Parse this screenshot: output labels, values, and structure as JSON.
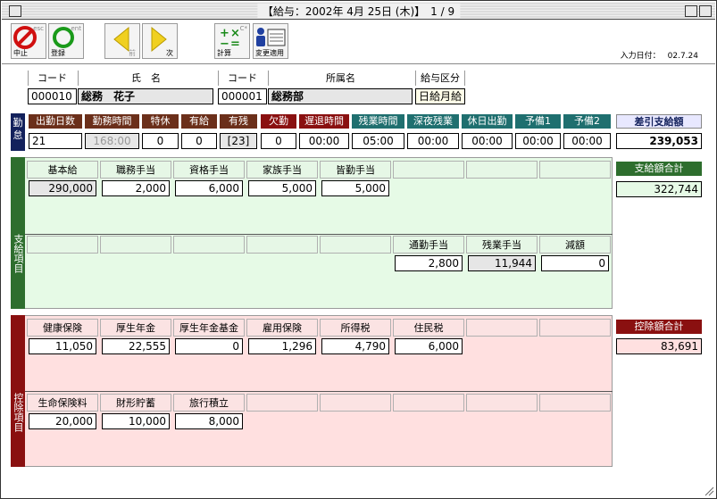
{
  "window": {
    "title": "【給与：2002年 4月 25日 (木)】　1 / 9"
  },
  "toolbar": {
    "stop_label": "中止",
    "stop_hint": "esc",
    "register_label": "登録",
    "register_hint": "ent",
    "prev_label": "前",
    "next_label": "次",
    "calc_label": "計算",
    "calc_hint": "C*",
    "apply_label": "変更適用",
    "input_date_label": "入力日付：",
    "input_date_value": "02.7.24"
  },
  "employee": {
    "code_header": "コード",
    "name_header": "氏　名",
    "dept_code_header": "コード",
    "dept_name_header": "所属名",
    "pay_type_header": "給与区分",
    "code": "000010",
    "name": "総務　花子",
    "dept_code": "000001",
    "dept_name": "総務部",
    "pay_type": "日給月給"
  },
  "attendance": {
    "side_label": "勤怠",
    "labels": [
      "出勤日数",
      "勤務時間",
      "特休",
      "有給",
      "有残",
      "欠勤",
      "遅退時間",
      "残業時間",
      "深夜残業",
      "休日出勤",
      "予備1",
      "予備2"
    ],
    "values": [
      "21",
      "168:00",
      "0",
      "0",
      "[23]",
      "0",
      "00:00",
      "05:00",
      "00:00",
      "00:00",
      "00:00",
      "00:00"
    ],
    "net_label": "差引支給額",
    "net_value": "239,053"
  },
  "payments": {
    "side_label": "支給項目",
    "row1_labels": [
      "基本給",
      "職務手当",
      "資格手当",
      "家族手当",
      "皆勤手当",
      "",
      "",
      ""
    ],
    "row1_values": [
      "290,000",
      "2,000",
      "6,000",
      "5,000",
      "5,000"
    ],
    "row2_labels": [
      "",
      "",
      "",
      "",
      "",
      "通勤手当",
      "残業手当",
      "減額"
    ],
    "row2_values": [
      "2,800",
      "11,944",
      "0"
    ],
    "total_label": "支給額合計",
    "total_value": "322,744"
  },
  "deductions": {
    "side_label": "控除項目",
    "row1_labels": [
      "健康保険",
      "厚生年金",
      "厚生年金基金",
      "雇用保険",
      "所得税",
      "住民税",
      "",
      ""
    ],
    "row1_values": [
      "11,050",
      "22,555",
      "0",
      "1,296",
      "4,790",
      "6,000"
    ],
    "row2_labels": [
      "生命保険料",
      "財形貯蓄",
      "旅行積立",
      "",
      "",
      "",
      "",
      ""
    ],
    "row2_values": [
      "20,000",
      "10,000",
      "8,000"
    ],
    "total_label": "控除額合計",
    "total_value": "83,691"
  },
  "colors": {
    "payments_bg": "#e6fae6",
    "deductions_bg": "#ffe0e0",
    "attendance_side": "#13215c",
    "payments_side": "#2e6e2e",
    "deductions_side": "#7a1010"
  }
}
